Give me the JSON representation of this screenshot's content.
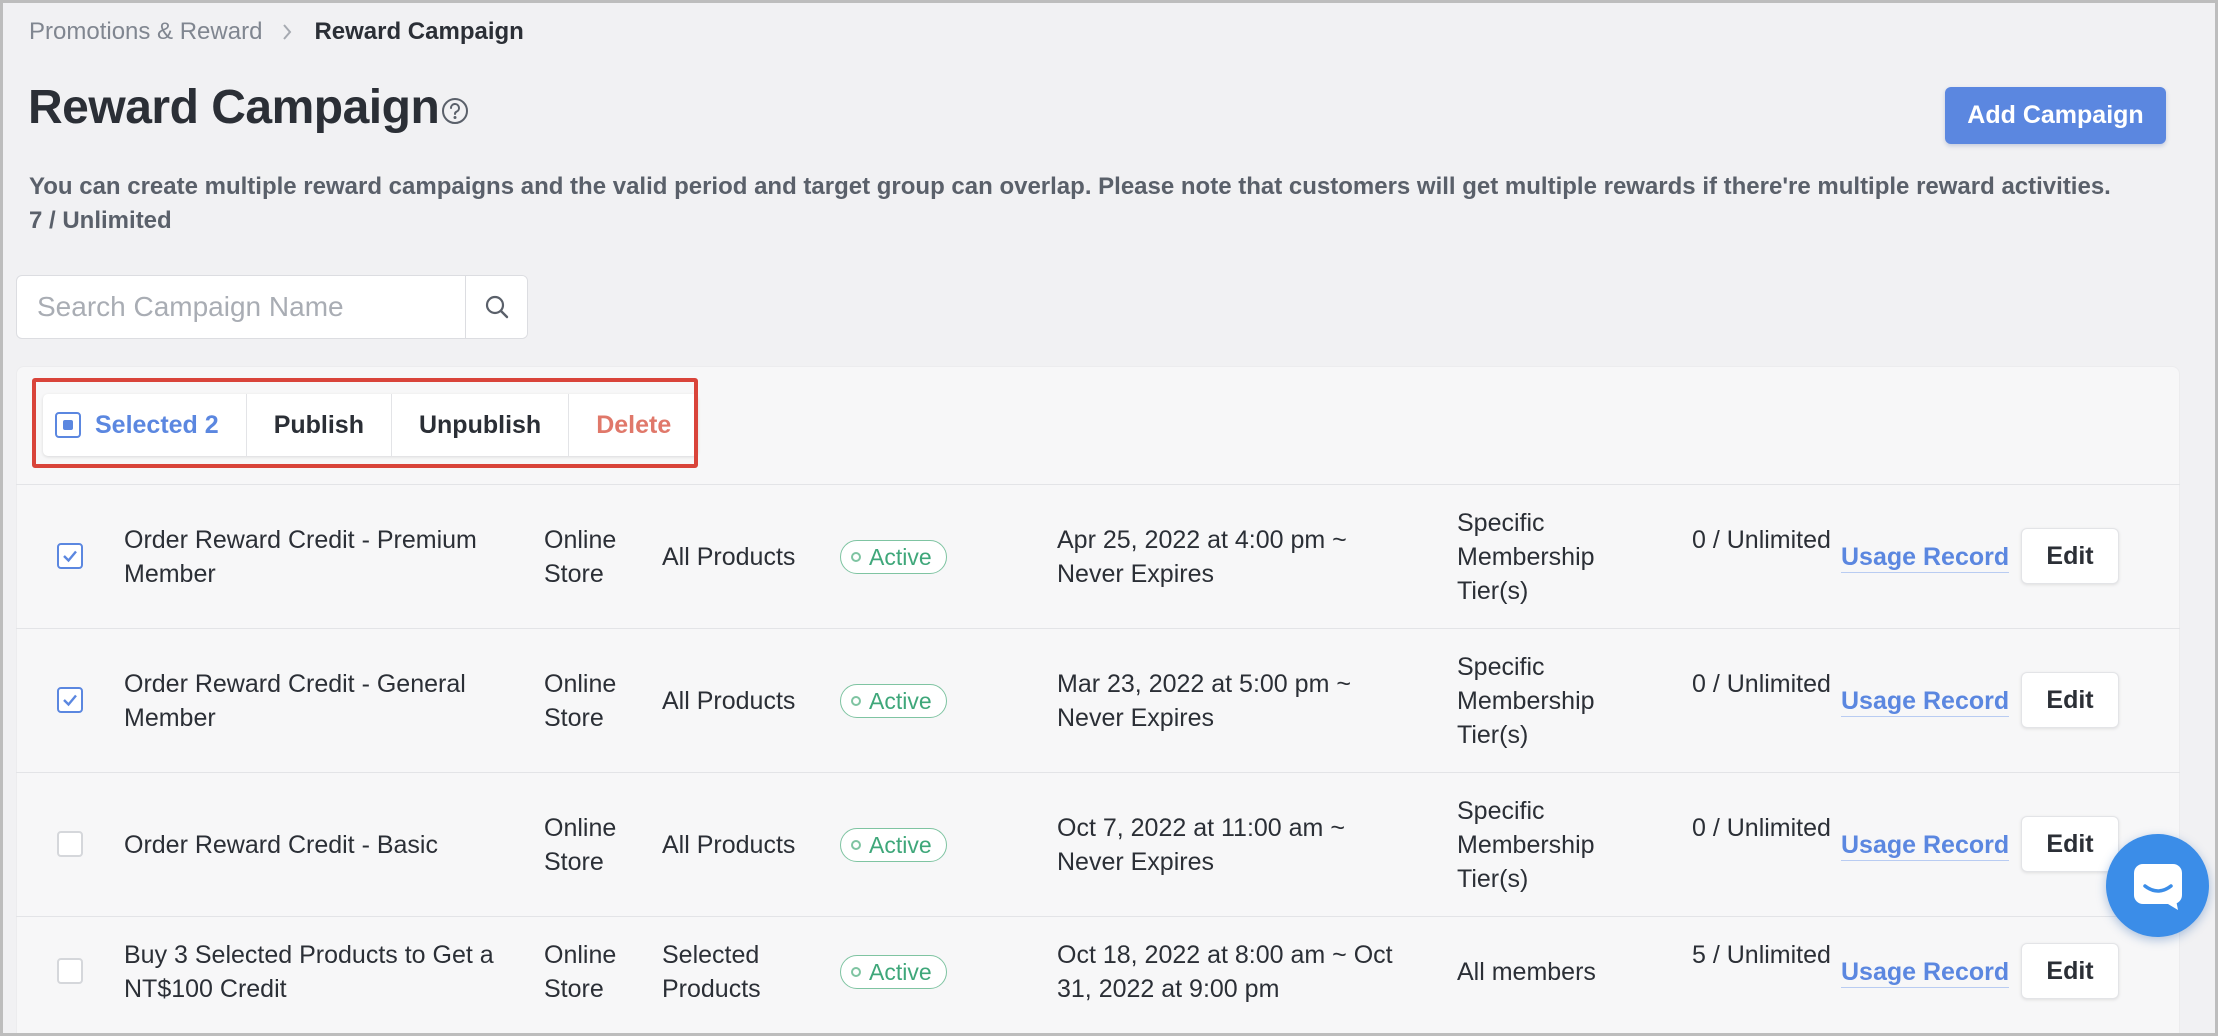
{
  "breadcrumb": {
    "parent": "Promotions & Reward",
    "current": "Reward Campaign"
  },
  "page": {
    "title": "Reward Campaign",
    "add_button": "Add Campaign",
    "description": "You can create multiple reward campaigns and the valid period and target group can overlap. Please note that customers will get multiple rewards if there're multiple reward activities.",
    "quota": "7 / Unlimited"
  },
  "search": {
    "placeholder": "Search Campaign Name",
    "value": ""
  },
  "bulk_actions": {
    "selected_label": "Selected 2",
    "publish": "Publish",
    "unpublish": "Unpublish",
    "delete": "Delete"
  },
  "rows": [
    {
      "checked": true,
      "name": "Order Reward Credit - Premium Member",
      "channel": "Online Store",
      "scope": "All Products",
      "status": "Active",
      "period": "Apr 25, 2022 at 4:00 pm ~ Never Expires",
      "target": "Specific Membership Tier(s)",
      "usage": "0 / Unlimited",
      "usage_link": "Usage Record",
      "edit": "Edit"
    },
    {
      "checked": true,
      "name": "Order Reward Credit - General Member",
      "channel": "Online Store",
      "scope": "All Products",
      "status": "Active",
      "period": "Mar 23, 2022 at 5:00 pm ~ Never Expires",
      "target": "Specific Membership Tier(s)",
      "usage": "0 / Unlimited",
      "usage_link": "Usage Record",
      "edit": "Edit"
    },
    {
      "checked": false,
      "name": "Order Reward Credit - Basic",
      "channel": "Online Store",
      "scope": "All Products",
      "status": "Active",
      "period": "Oct 7, 2022 at 11:00 am ~ Never Expires",
      "target": "Specific Membership Tier(s)",
      "usage": "0 / Unlimited",
      "usage_link": "Usage Record",
      "edit": "Edit"
    },
    {
      "checked": false,
      "name": "Buy 3 Selected Products to Get a NT$100 Credit",
      "channel": "Online Store",
      "scope": "Selected Products",
      "status": "Active",
      "period": "Oct 18, 2022 at 8:00 am ~ Oct 31, 2022 at 9:00 pm",
      "target": "All members",
      "usage": "5 / Unlimited",
      "usage_link": "Usage Record",
      "edit": "Edit"
    }
  ],
  "colors": {
    "accent": "#5b87e0",
    "danger": "#e0786a",
    "highlight_border": "#d9443a",
    "status_active": "#3fa77a",
    "chat": "#3b8de8"
  },
  "icons": {
    "breadcrumb_separator": "chevron-right-icon",
    "help": "question-circle-icon",
    "search": "search-icon",
    "checkbox_checked": "check-icon",
    "chat": "chat-icon"
  }
}
